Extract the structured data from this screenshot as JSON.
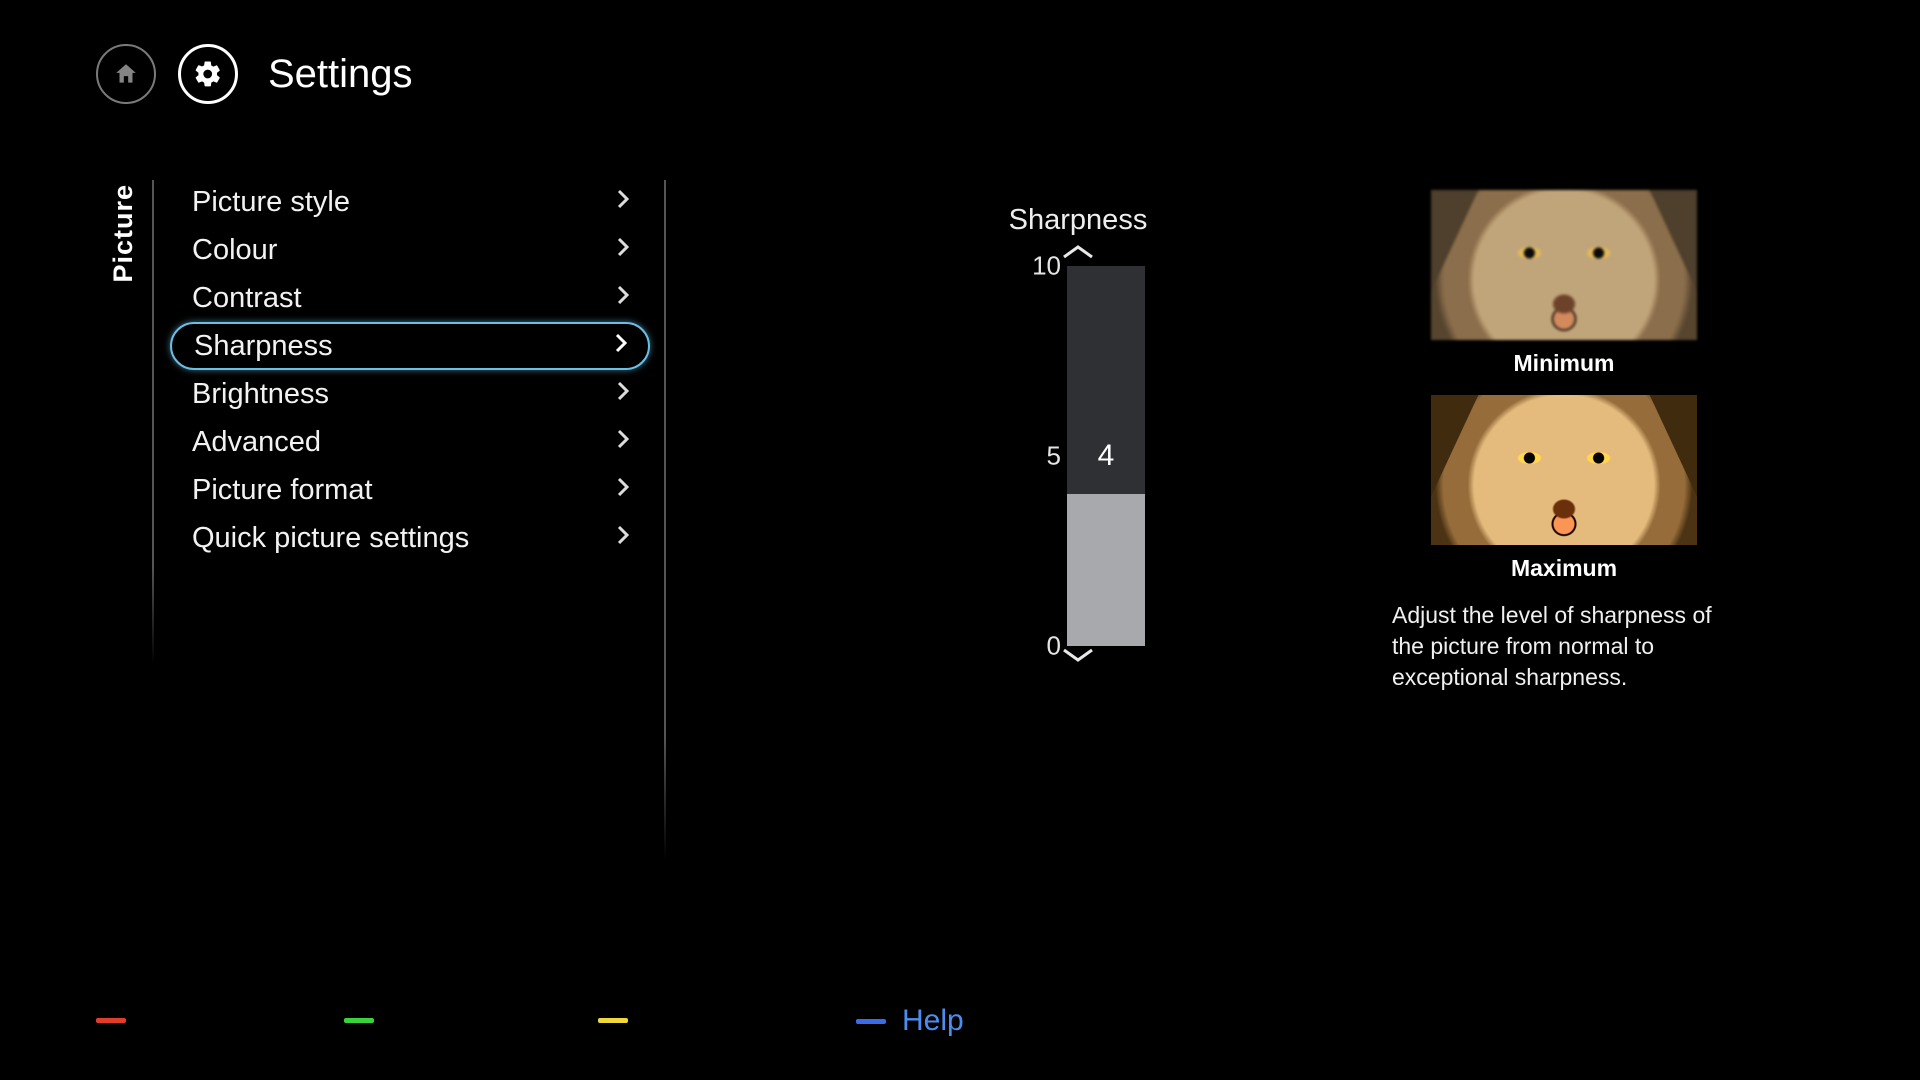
{
  "header": {
    "title": "Settings"
  },
  "sideTab": "Picture",
  "menu": {
    "items": [
      {
        "label": "Picture style",
        "selected": false
      },
      {
        "label": "Colour",
        "selected": false
      },
      {
        "label": "Contrast",
        "selected": false
      },
      {
        "label": "Sharpness",
        "selected": true
      },
      {
        "label": "Brightness",
        "selected": false
      },
      {
        "label": "Advanced",
        "selected": false
      },
      {
        "label": "Picture format",
        "selected": false
      },
      {
        "label": "Quick picture settings",
        "selected": false
      }
    ]
  },
  "slider": {
    "title": "Sharpness",
    "max": 10,
    "mid": 5,
    "min": 0,
    "value": 4
  },
  "info": {
    "minLabel": "Minimum",
    "maxLabel": "Maximum",
    "description": "Adjust the level of sharpness of the picture from normal to exceptional sharpness."
  },
  "footer": {
    "help": "Help"
  },
  "colors": {
    "highlight": "#6bbfe5"
  }
}
